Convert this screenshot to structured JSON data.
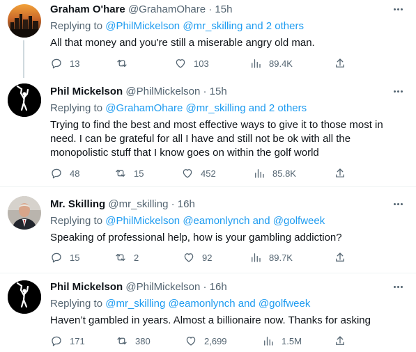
{
  "colors": {
    "accent": "#1d9bf0",
    "muted": "#536471",
    "text": "#0f1419"
  },
  "tweets": [
    {
      "name": "Graham O'hare",
      "handle": "@GrahamOhare",
      "separator": "·",
      "time": "15h",
      "reply_prefix": "Replying to",
      "mentions": "@PhilMickelson @mr_skilling and 2 others",
      "lines": [
        "All that money and you're still a miserable angry old man."
      ],
      "replies": "13",
      "retweets": "",
      "likes": "103",
      "views": "89.4K",
      "avatar": "city-skyline-photo"
    },
    {
      "name": "Phil Mickelson",
      "handle": "@PhilMickelson",
      "separator": "·",
      "time": "15h",
      "reply_prefix": "Replying to",
      "mentions": "@GrahamOhare @mr_skilling and 2 others",
      "lines": [
        "Trying to find the best and most effective ways to give it to those most in",
        "need. I can be grateful for all I have and still not be ok with all the",
        "monopolistic stuff that I know goes on within the golf world"
      ],
      "replies": "48",
      "retweets": "15",
      "likes": "452",
      "views": "85.8K",
      "avatar": "golfer-silhouette"
    },
    {
      "name": "Mr. Skilling",
      "handle": "@mr_skilling",
      "separator": "·",
      "time": "16h",
      "reply_prefix": "Replying to",
      "mentions": "@PhilMickelson @eamonlynch and @golfweek",
      "lines": [
        "Speaking of professional help, how is your gambling addiction?"
      ],
      "replies": "15",
      "retweets": "2",
      "likes": "92",
      "views": "89.7K",
      "avatar": "man-in-suit-photo"
    },
    {
      "name": "Phil Mickelson",
      "handle": "@PhilMickelson",
      "separator": "·",
      "time": "16h",
      "reply_prefix": "Replying to",
      "mentions": "@mr_skilling @eamonlynch and @golfweek",
      "lines": [
        "Haven’t gambled in years. Almost a billionaire now. Thanks for asking"
      ],
      "replies": "171",
      "retweets": "380",
      "likes": "2,699",
      "views": "1.5M",
      "avatar": "golfer-silhouette"
    }
  ]
}
